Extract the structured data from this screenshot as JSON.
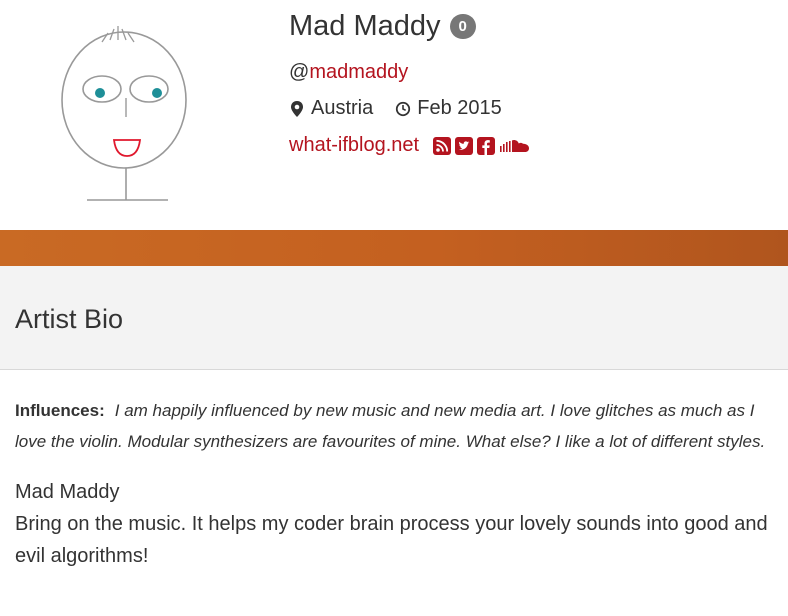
{
  "profile": {
    "name": "Mad Maddy",
    "badge_count": "0",
    "handle_prefix": "@",
    "handle": "madmaddy",
    "location": "Austria",
    "joined": "Feb 2015",
    "website": "what-ifblog.net",
    "social_icons": [
      "rss-icon",
      "twitter-icon",
      "facebook-icon",
      "soundcloud-icon"
    ]
  },
  "colors": {
    "link": "#b4141f",
    "banner": "#c46020",
    "badge": "#777777"
  },
  "bio_panel": {
    "title": "Artist Bio",
    "influences_label": "Influences:",
    "influences_text": "I am happily influenced by new music and new media art. I love glitches as much as I love the violin. Modular synthesizers are favourites of mine. What else? I like a lot of different styles.",
    "artist_name": "Mad Maddy",
    "artist_text": "Bring on the music. It helps my coder brain process your lovely sounds into good and evil algorithms!"
  }
}
